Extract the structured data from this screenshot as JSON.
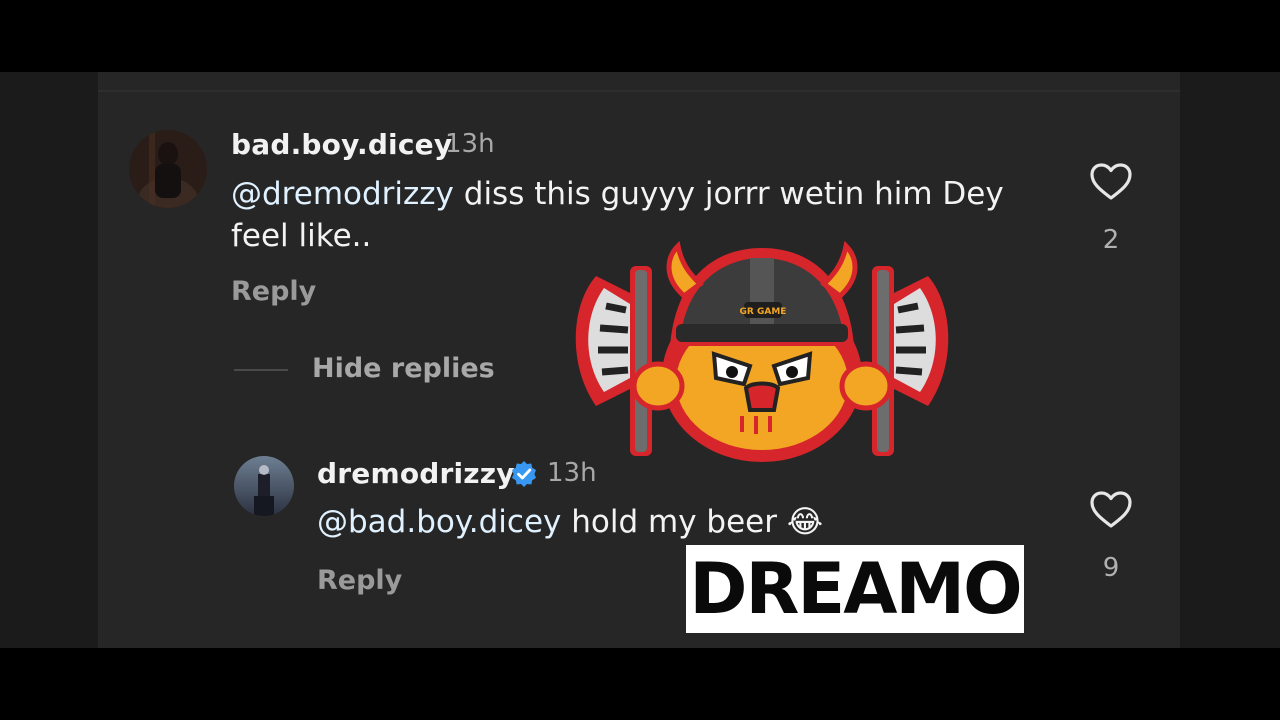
{
  "comments": [
    {
      "username": "bad.boy.dicey",
      "time": "13h",
      "mention": "@dremodrizzy",
      "text_line1": " diss this guyyy jorrr wetin him Dey",
      "text_line2": "feel like..",
      "reply_label": "Reply",
      "likes": "2"
    }
  ],
  "replies_toggle": "Hide replies",
  "reply": {
    "username": "dremodrizzy",
    "verified": true,
    "time": "13h",
    "mention": "@bad.boy.dicey",
    "text": " hold my beer ",
    "emoji": "😂",
    "reply_label": "Reply",
    "likes": "9"
  },
  "overlay": {
    "mascot_text": "GR GAME",
    "brand_text": "DREAMO"
  },
  "colors": {
    "panel_bg": "#262626",
    "mention": "#e0f1ff",
    "verified_badge": "#3897f0",
    "mascot_outline": "#d7262b",
    "mascot_face": "#f2a623"
  },
  "icons": {
    "like": "heart-outline-icon",
    "verified": "verified-badge-icon"
  }
}
